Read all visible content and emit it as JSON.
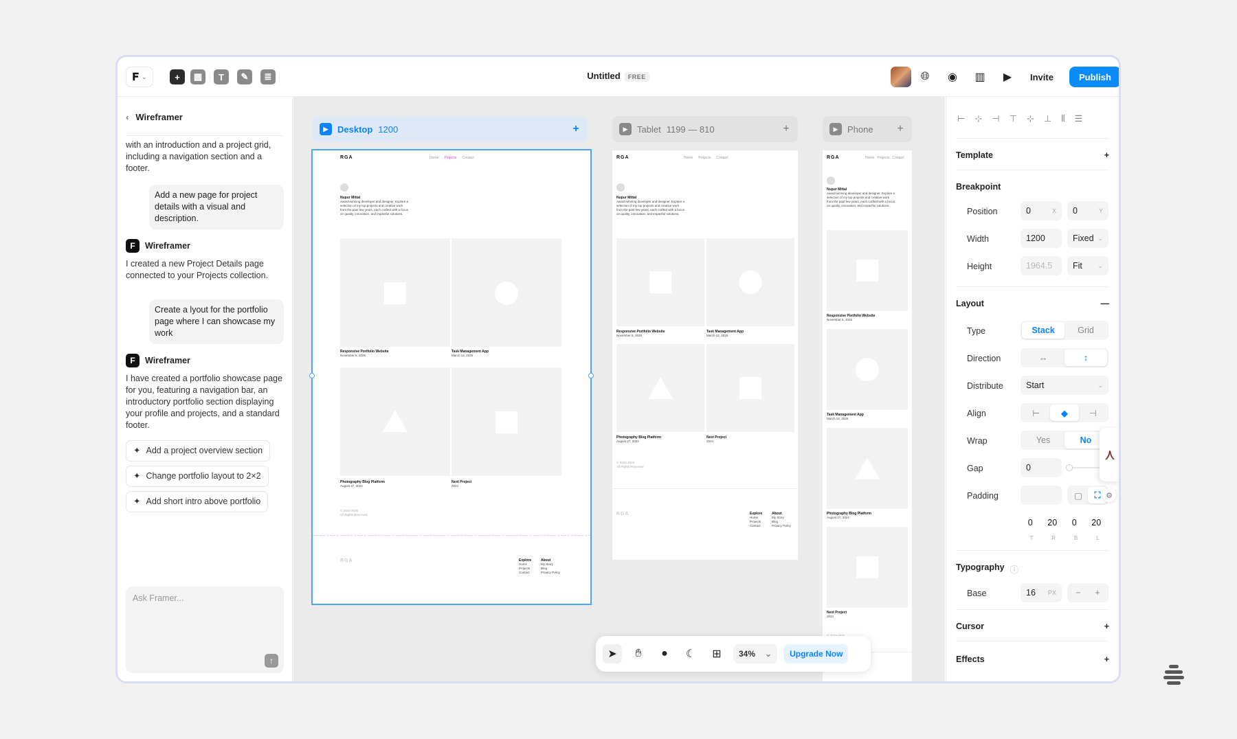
{
  "topbar": {
    "title": "Untitled",
    "plan_badge": "FREE",
    "invite_label": "Invite",
    "publish_label": "Publish",
    "tool_icons": [
      "insert-icon",
      "layout-icon",
      "text-icon",
      "pen-icon",
      "cms-icon"
    ],
    "right_icons": [
      "globe-icon",
      "record-icon",
      "analytics-icon",
      "play-icon"
    ]
  },
  "left_panel": {
    "header": "Wireframer",
    "intro_text": "I created your personal portfolio page with an introduction and a project grid, including a navigation section and a footer.",
    "messages": [
      {
        "role": "user",
        "text": "Add a new page for project details with a visual and description."
      },
      {
        "role": "bot",
        "name": "Wireframer",
        "text": "I created a new Project Details page connected to your Projects collection."
      },
      {
        "role": "user",
        "text": "Create a lyout for the portfolio page where I can showcase my work"
      },
      {
        "role": "bot",
        "name": "Wireframer",
        "text": "I have created a portfolio showcase page for you, featuring a navigation bar, an introductory portfolio section displaying your profile and projects, and a standard footer."
      }
    ],
    "suggestions": [
      "Add a project overview section",
      "Change portfolio layout to 2×2",
      "Add short intro above portfolio"
    ],
    "ask_placeholder": "Ask Framer..."
  },
  "canvas": {
    "breakpoints": [
      {
        "name": "Desktop",
        "size": "1200"
      },
      {
        "name": "Tablet",
        "size": "1199 — 810"
      },
      {
        "name": "Phone",
        "size": ""
      }
    ],
    "site": {
      "logo": "RGA",
      "nav": [
        "Home",
        "Projects",
        "Contact"
      ],
      "author": "Nupur Mittal",
      "bio": "Award-winning developer and designer. Explore a selection of my top projects and creative work from the past few years, each crafted with a focus on quality, innovation, and impactful solutions.",
      "projects": [
        {
          "name": "Responsive Portfolio Website",
          "date": "November 5, 2025"
        },
        {
          "name": "Task Management App",
          "date": "March 12, 2025"
        },
        {
          "name": "Photography Blog Platform",
          "date": "August 27, 2024"
        },
        {
          "name": "Next Project",
          "date": "2024"
        }
      ],
      "copyright": "© 2023-2025",
      "rights": "All Rights Reserved",
      "footer_explore": [
        "Explore",
        "Home",
        "Projects",
        "Contact"
      ],
      "footer_about": [
        "About",
        "My Story",
        "Blog",
        "Privacy Policy"
      ]
    },
    "toolbar": {
      "zoom": "34%",
      "upgrade_label": "Upgrade Now"
    }
  },
  "right_panel": {
    "template_label": "Template",
    "breakpoint_label": "Breakpoint",
    "position_label": "Position",
    "position_x": "0",
    "position_y": "0",
    "x_unit": "X",
    "y_unit": "Y",
    "width_label": "Width",
    "width_value": "1200",
    "width_mode": "Fixed",
    "height_label": "Height",
    "height_value": "1964.5",
    "height_mode": "Fit",
    "layout_label": "Layout",
    "type_label": "Type",
    "type_options": [
      "Stack",
      "Grid"
    ],
    "direction_label": "Direction",
    "distribute_label": "Distribute",
    "distribute_value": "Start",
    "align_label": "Align",
    "wrap_label": "Wrap",
    "wrap_options": [
      "Yes",
      "No"
    ],
    "gap_label": "Gap",
    "gap_value": "0",
    "padding_label": "Padding",
    "padding_values": [
      "0",
      "20",
      "0",
      "20"
    ],
    "padding_sides": [
      "T",
      "R",
      "B",
      "L"
    ],
    "typography_label": "Typography",
    "base_label": "Base",
    "base_value": "16",
    "base_unit": "PX",
    "cursor_label": "Cursor",
    "effects_label": "Effects"
  },
  "colors": {
    "accent": "#0a8cff",
    "canvas": "#ebebeb"
  }
}
